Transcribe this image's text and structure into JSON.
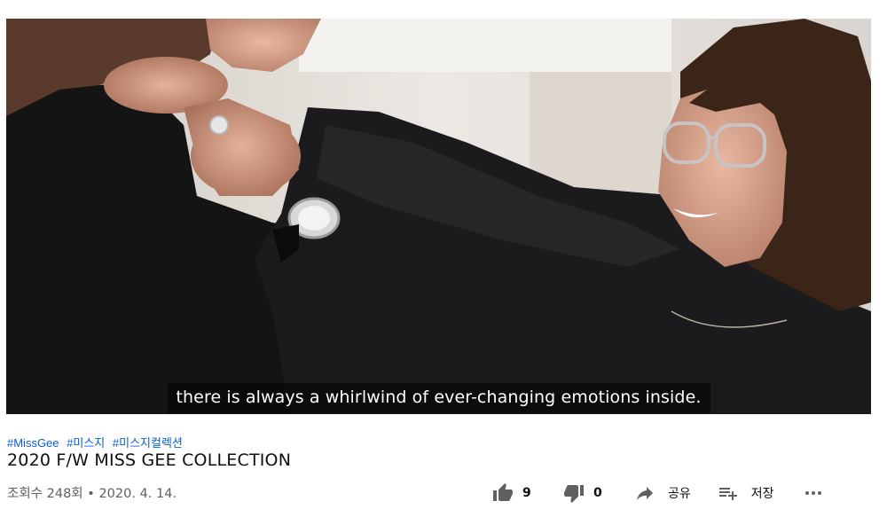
{
  "video": {
    "caption": "there is always a whirlwind of ever-changing emotions inside."
  },
  "hashtags": [
    "#MissGee",
    "#미스지",
    "#미스지컬렉션"
  ],
  "title": "2020 F/W MISS GEE COLLECTION",
  "meta": {
    "views": "조회수 248회",
    "separator": "•",
    "date": "2020. 4. 14."
  },
  "actions": {
    "like_count": "9",
    "dislike_count": "0",
    "share_label": "공유",
    "save_label": "저장"
  },
  "icons": {
    "like": "thumbs-up-icon",
    "dislike": "thumbs-down-icon",
    "share": "share-arrow-icon",
    "save": "playlist-add-icon",
    "more": "more-horizontal-icon"
  },
  "colors": {
    "link": "#065fd4",
    "meta_text": "#606060",
    "caption_bg": "#080808"
  }
}
